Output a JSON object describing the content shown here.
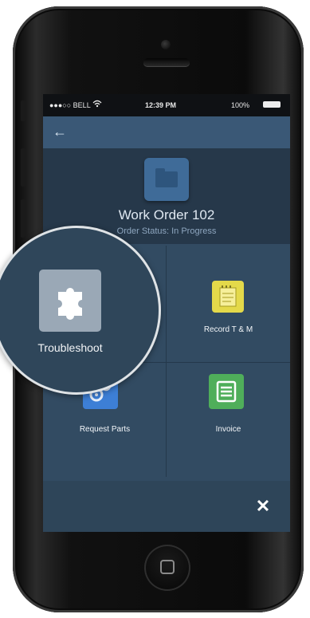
{
  "status_bar": {
    "carrier": "●●●○○ BELL",
    "time": "12:39 PM",
    "battery": "100%"
  },
  "navbar": {
    "back_icon": "arrow-left-icon"
  },
  "work_order": {
    "title": "Work Order 102",
    "status": "Order Status: In Progress",
    "icon": "folder-icon"
  },
  "actions": [
    {
      "label": "Troubleshoot",
      "icon": "puzzle-icon",
      "color": "#9aa8b6"
    },
    {
      "label": "Record T & M",
      "icon": "notepad-icon",
      "color": "#e4d94a"
    },
    {
      "label": "Request Parts",
      "icon": "gears-icon",
      "color": "#3d7fd6"
    },
    {
      "label": "Invoice",
      "icon": "document-list-icon",
      "color": "#4fae5a"
    }
  ],
  "close_icon": "close-icon",
  "colors": {
    "screen_bg": "#324b62",
    "header_bg": "#26384a",
    "nav_bg": "#3a5876"
  }
}
